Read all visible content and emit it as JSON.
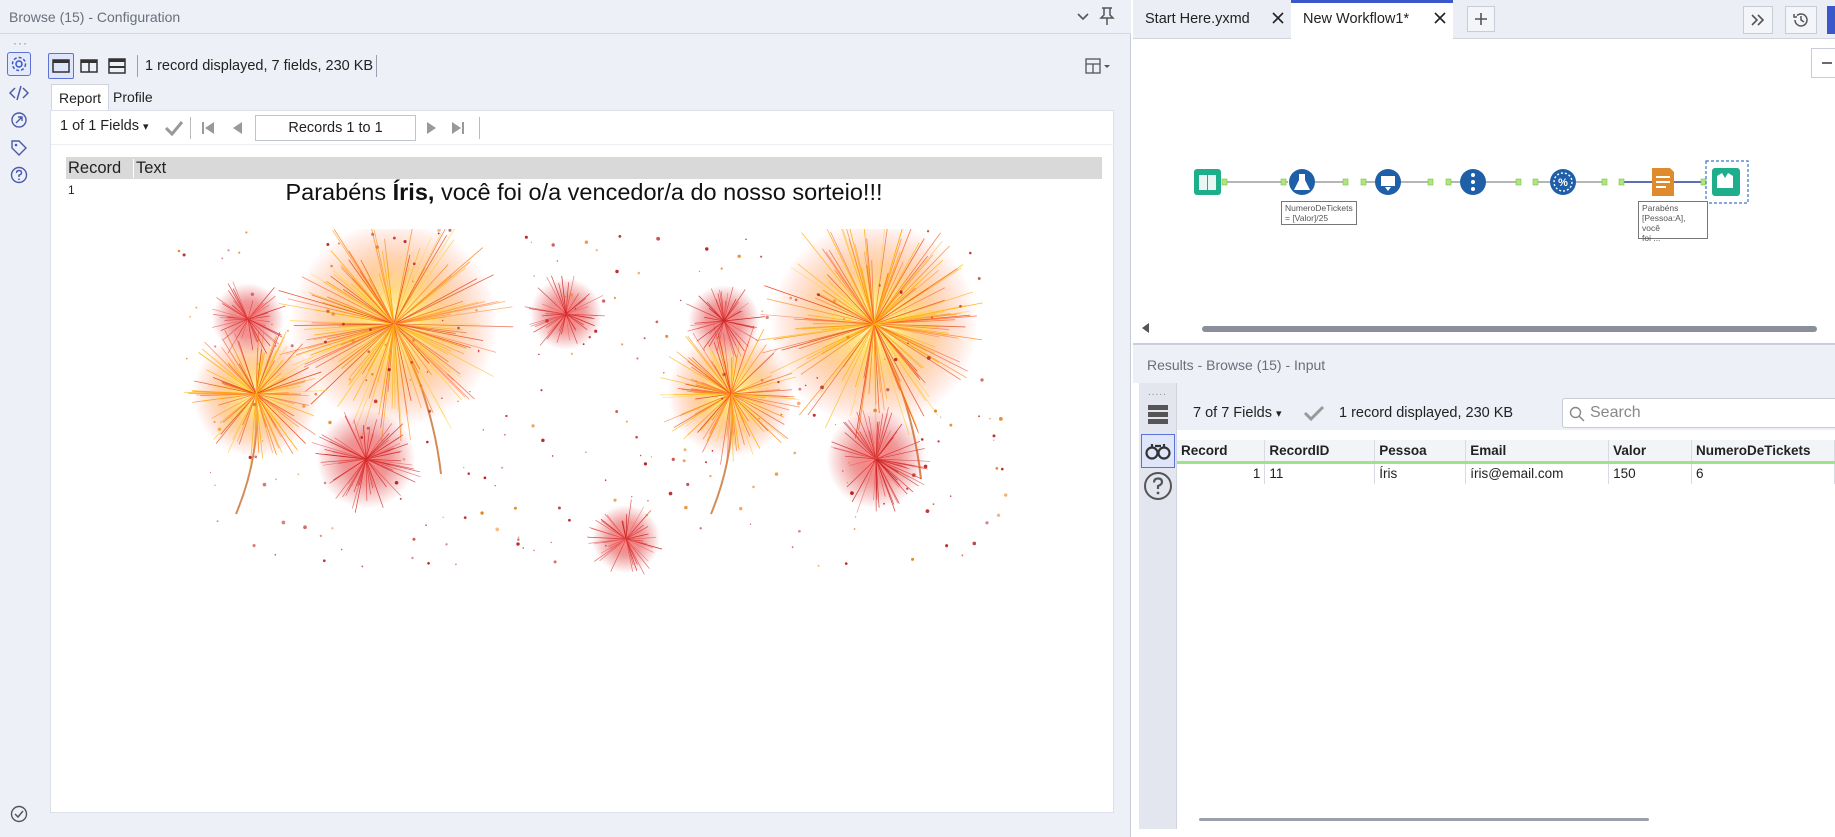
{
  "config": {
    "title": "Browse (15) - Configuration",
    "toolbar_info": "1 record displayed, 7 fields, 230 KB",
    "tabs": [
      "Report",
      "Profile"
    ],
    "fields_select": "1 of 1 Fields",
    "records_label": "Records 1 to 1",
    "table_header": {
      "record": "Record",
      "text": "Text"
    },
    "row_number": "1",
    "message_prefix": "Parabéns ",
    "message_name": "Íris,",
    "message_suffix": " você foi o/a vencedor/a do nosso sorteio!!!"
  },
  "workflow": {
    "tabs": [
      {
        "label": "Start Here.yxmd",
        "active": false
      },
      {
        "label": "New Workflow1*",
        "active": true
      }
    ],
    "formula_label_1": "NumeroDeTickets",
    "formula_label_2": "= [Valor]/25",
    "report_label_1": "Parabéns",
    "report_label_2": "[Pessoa:A], você",
    "report_label_3": "foi ..."
  },
  "results": {
    "title": "Results - Browse (15) - Input",
    "fields_select": "7 of 7 Fields",
    "info": "1 record displayed, 230 KB",
    "search_placeholder": "Search",
    "columns": [
      "Record",
      "RecordID",
      "Pessoa",
      "Email",
      "Valor",
      "NumeroDeTickets"
    ],
    "rows": [
      [
        "1",
        "11",
        "Íris",
        "íris@email.com",
        "150",
        "6"
      ]
    ]
  },
  "colors": {
    "accent": "#3a58c9",
    "tool_teal": "#16a085",
    "tool_blue": "#1f5fa8",
    "tool_orange": "#e08a2e",
    "header_gray": "#d9d9d9",
    "field_green": "#9ee28a"
  }
}
